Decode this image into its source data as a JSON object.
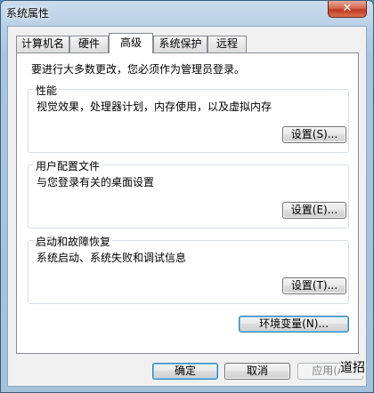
{
  "window": {
    "title": "系统属性",
    "close_label": "✕"
  },
  "tabs": [
    {
      "label": "计算机名"
    },
    {
      "label": "硬件"
    },
    {
      "label": "高级"
    },
    {
      "label": "系统保护"
    },
    {
      "label": "远程"
    }
  ],
  "panel": {
    "admin_note": "要进行大多数更改，您必须作为管理员登录。",
    "performance": {
      "title": "性能",
      "desc": "视觉效果，处理器计划，内存使用，以及虚拟内存",
      "button": "设置(S)..."
    },
    "user_profiles": {
      "title": "用户配置文件",
      "desc": "与您登录有关的桌面设置",
      "button": "设置(E)..."
    },
    "startup_recovery": {
      "title": "启动和故障恢复",
      "desc": "系统启动、系统失败和调试信息",
      "button": "设置(T)..."
    },
    "env_button": "环境变量(N)..."
  },
  "footer": {
    "ok": "确定",
    "cancel": "取消",
    "apply": "应用(A)"
  },
  "watermark": "道招"
}
